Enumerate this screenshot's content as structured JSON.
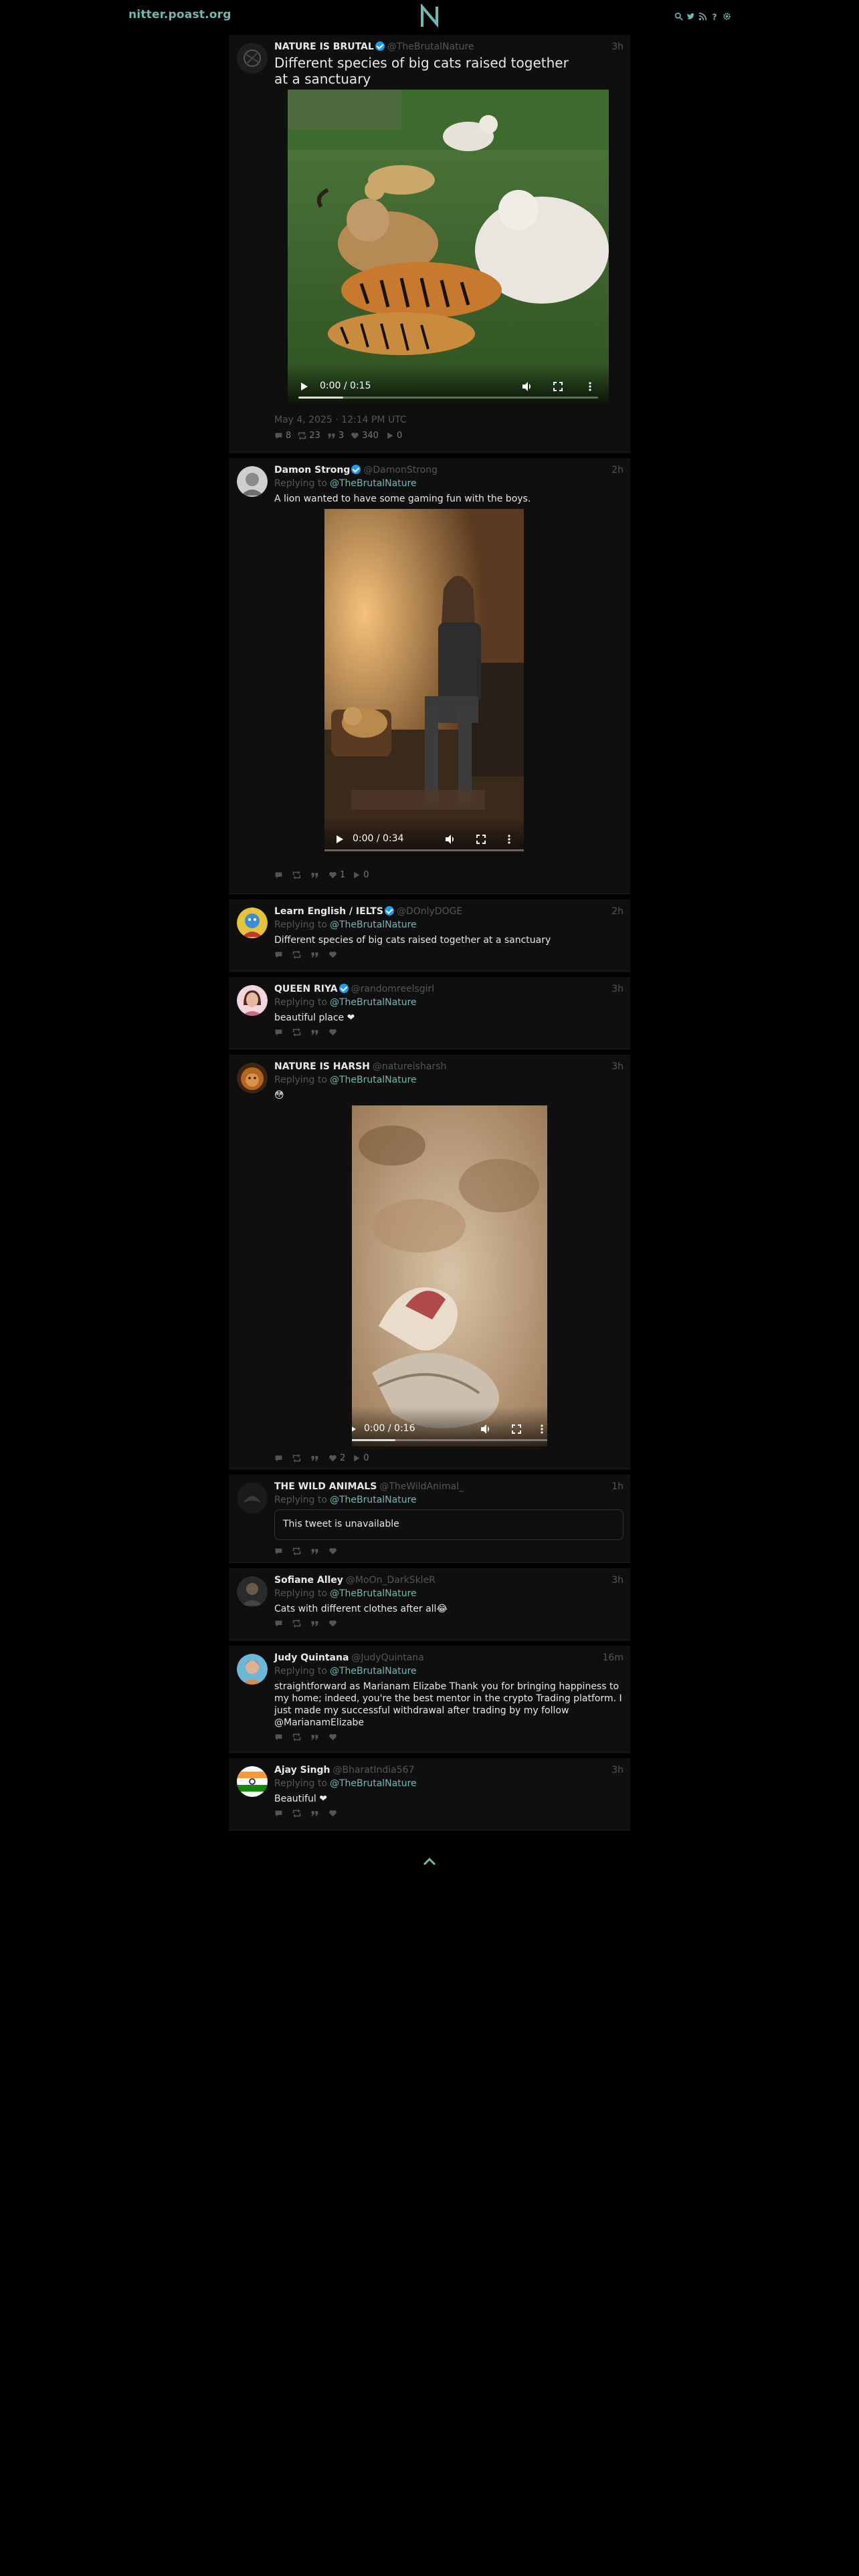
{
  "nav": {
    "site": "nitter.poast.org",
    "icons": [
      "search-icon",
      "twitter-icon",
      "rss-icon",
      "info-icon",
      "settings-icon"
    ]
  },
  "colors": {
    "accent": "#73b7b1",
    "bg": "#000000",
    "panel": "#0f0f0f",
    "muted": "#555555"
  },
  "main_tweet": {
    "fullname": "NATURE IS BRUTAL",
    "verified": true,
    "username": "@TheBrutalNature",
    "date": "3h",
    "text": "Different species of big cats raised together at a sanctuary",
    "video": {
      "time": "0:00 / 0:15",
      "progress": 0.15
    },
    "published": "May 4, 2025 · 12:14 PM UTC",
    "stats": {
      "replies": "8",
      "retweets": "23",
      "quotes": "3",
      "likes": "340",
      "views": "0"
    }
  },
  "replies": [
    {
      "fullname": "Damon Strong",
      "verified": true,
      "username": "@DamonStrong",
      "date": "2h",
      "replying_label": "Replying to",
      "replying_to": "@TheBrutalNature",
      "text": "A lion wanted to have some gaming fun with the boys.",
      "video": {
        "time": "0:00 / 0:34",
        "progress": 0.0
      },
      "stats": {
        "replies": "",
        "retweets": "",
        "quotes": "",
        "likes": "1",
        "views": "0"
      }
    },
    {
      "fullname": "Learn English / IELTS",
      "verified": true,
      "username": "@DOnlyDOGE",
      "date": "2h",
      "replying_label": "Replying to",
      "replying_to": "@TheBrutalNature",
      "text": "Different species of big cats raised together at a sanctuary",
      "stats": {
        "replies": "",
        "retweets": "",
        "quotes": "",
        "likes": ""
      }
    },
    {
      "fullname": "QUEEN RIYA",
      "verified": true,
      "username": "@randomreelsgirl",
      "date": "3h",
      "replying_label": "Replying to",
      "replying_to": "@TheBrutalNature",
      "text": "beautiful place ❤",
      "stats": {
        "replies": "",
        "retweets": "",
        "quotes": "",
        "likes": ""
      }
    },
    {
      "fullname": "NATURE IS HARSH",
      "verified": false,
      "username": "@natureisharsh",
      "date": "3h",
      "replying_label": "Replying to",
      "replying_to": "@TheBrutalNature",
      "text": "😳",
      "video": {
        "time": "0:00 / 0:16",
        "progress": 0.25
      },
      "stats": {
        "replies": "",
        "retweets": "",
        "quotes": "",
        "likes": "2",
        "views": "0"
      }
    },
    {
      "fullname": "THE WILD ANIMALS",
      "verified": false,
      "username": "@TheWildAnimal_",
      "date": "1h",
      "replying_label": "Replying to",
      "replying_to": "@TheBrutalNature",
      "unavailable": "This tweet is unavailable",
      "stats": {
        "replies": "",
        "retweets": "",
        "quotes": "",
        "likes": ""
      }
    },
    {
      "fullname": "Sofiane Alley",
      "verified": false,
      "username": "@MoOn_DarkSkleR",
      "date": "3h",
      "replying_label": "Replying to",
      "replying_to": "@TheBrutalNature",
      "text": "Cats with different clothes after all😂",
      "stats": {
        "replies": "",
        "retweets": "",
        "quotes": "",
        "likes": ""
      }
    },
    {
      "fullname": "Judy Quintana",
      "verified": false,
      "username": "@JudyQuintana",
      "date": "16m",
      "replying_label": "Replying to",
      "replying_to": "@TheBrutalNature",
      "text": "straightforward as Marianam Elizabe Thank you for bringing happiness to my home; indeed, you're the best mentor in the crypto Trading platform. I just made my successful withdrawal after trading by my follow @MarianamElizabe",
      "stats": {
        "replies": "",
        "retweets": "",
        "quotes": "",
        "likes": ""
      }
    },
    {
      "fullname": "Ajay Singh",
      "verified": false,
      "username": "@BharatIndia567",
      "date": "3h",
      "replying_label": "Replying to",
      "replying_to": "@TheBrutalNature",
      "text": "Beautiful ❤",
      "stats": {
        "replies": "",
        "retweets": "",
        "quotes": "",
        "likes": ""
      }
    }
  ]
}
